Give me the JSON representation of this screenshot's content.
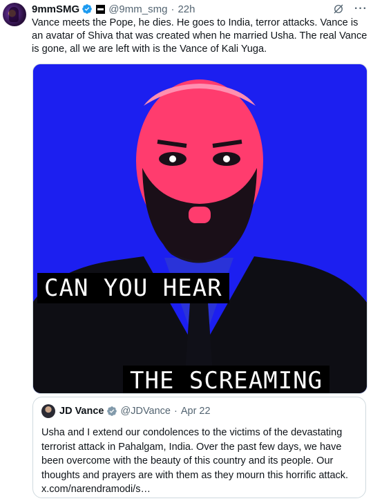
{
  "tweet": {
    "display_name": "9mmSMG",
    "handle": "@9mm_smg",
    "time": "22h",
    "separator": "·",
    "text": "Vance meets the Pope, he dies. He goes to India, terror attacks. Vance is an avatar of Shiva that was created when he married Usha. The real Vance is gone, all we are left with is the Vance of Kali Yuga.",
    "icons": [
      "verified-badge-icon",
      "flag-badge-icon",
      "grok-icon",
      "more-icon"
    ],
    "more_glyph": "···"
  },
  "media": {
    "caption_top": "CAN YOU HEAR",
    "caption_bottom": "THE SCREAMING",
    "colors": {
      "background": "#1c1ff0",
      "face": "#ff3c6e",
      "suit": "#111111"
    }
  },
  "quote": {
    "display_name": "JD Vance",
    "handle": "@JDVance",
    "separator": "·",
    "date": "Apr 22",
    "text": "Usha and I extend our condolences to the victims of the devastating terrorist attack in Pahalgam, India. Over the past few days, we have been overcome with the beauty of this country and its people. Our thoughts and prayers are with them as they mourn this horrific attack. x.com/narendramodi/s…"
  },
  "colors": {
    "accent_blue": "#1d9bf0",
    "gray_verified": "#829aab",
    "text_secondary": "#536471"
  }
}
